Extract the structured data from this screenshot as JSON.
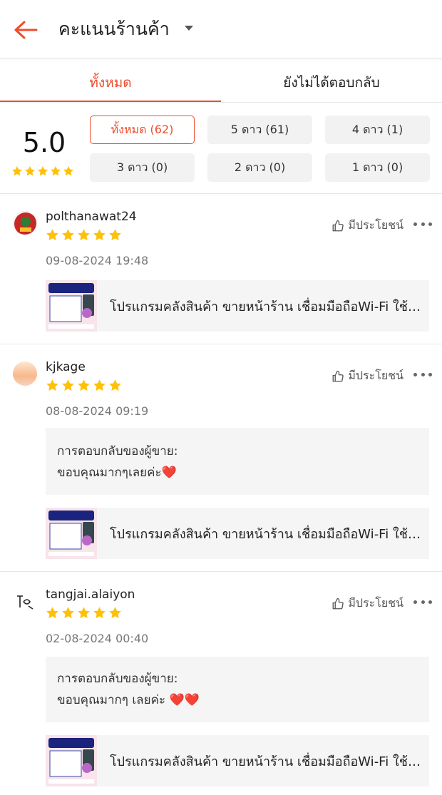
{
  "header": {
    "title": "คะแนนร้านค้า"
  },
  "tabs": [
    {
      "label": "ทั้งหมด",
      "active": true
    },
    {
      "label": "ยังไม่ได้ตอบกลับ",
      "active": false
    }
  ],
  "summary": {
    "score": "5.0",
    "stars": 5,
    "filters": [
      {
        "label": "ทั้งหมด (62)",
        "selected": true
      },
      {
        "label": "5 ดาว (61)",
        "selected": false
      },
      {
        "label": "4 ดาว (1)",
        "selected": false
      },
      {
        "label": "3 ดาว (0)",
        "selected": false
      },
      {
        "label": "2 ดาว (0)",
        "selected": false
      },
      {
        "label": "1 ดาว (0)",
        "selected": false
      }
    ]
  },
  "helpful_label": "มีประโยชน์",
  "reviews": [
    {
      "username": "polthanawat24",
      "stars": 5,
      "date": "09-08-2024 19:48",
      "product": "โปรแกรมคลังสินค้า ขายหน้าร้าน เชื่อมมือถือWi-Fi ใช้งานง่าย"
    },
    {
      "username": "kjkage",
      "stars": 5,
      "date": "08-08-2024 09:19",
      "reply_label": "การตอบกลับของผู้ขาย:",
      "reply_text": "ขอบคุณมากๆเลยค่ะ❤️",
      "product": "โปรแกรมคลังสินค้า ขายหน้าร้าน เชื่อมมือถือWi-Fi ใช้งานง่าย"
    },
    {
      "username": "tangjai.alaiyon",
      "stars": 5,
      "date": "02-08-2024 00:40",
      "reply_label": "การตอบกลับของผู้ขาย:",
      "reply_text": "ขอบคุณมากๆ เลยค่ะ ❤️❤️",
      "product": "โปรแกรมคลังสินค้า ขายหน้าร้าน เชื่อมมือถือWi-Fi ใช้งานง่าย"
    }
  ],
  "colors": {
    "accent": "#ee4d2d",
    "star": "#ffc107"
  }
}
